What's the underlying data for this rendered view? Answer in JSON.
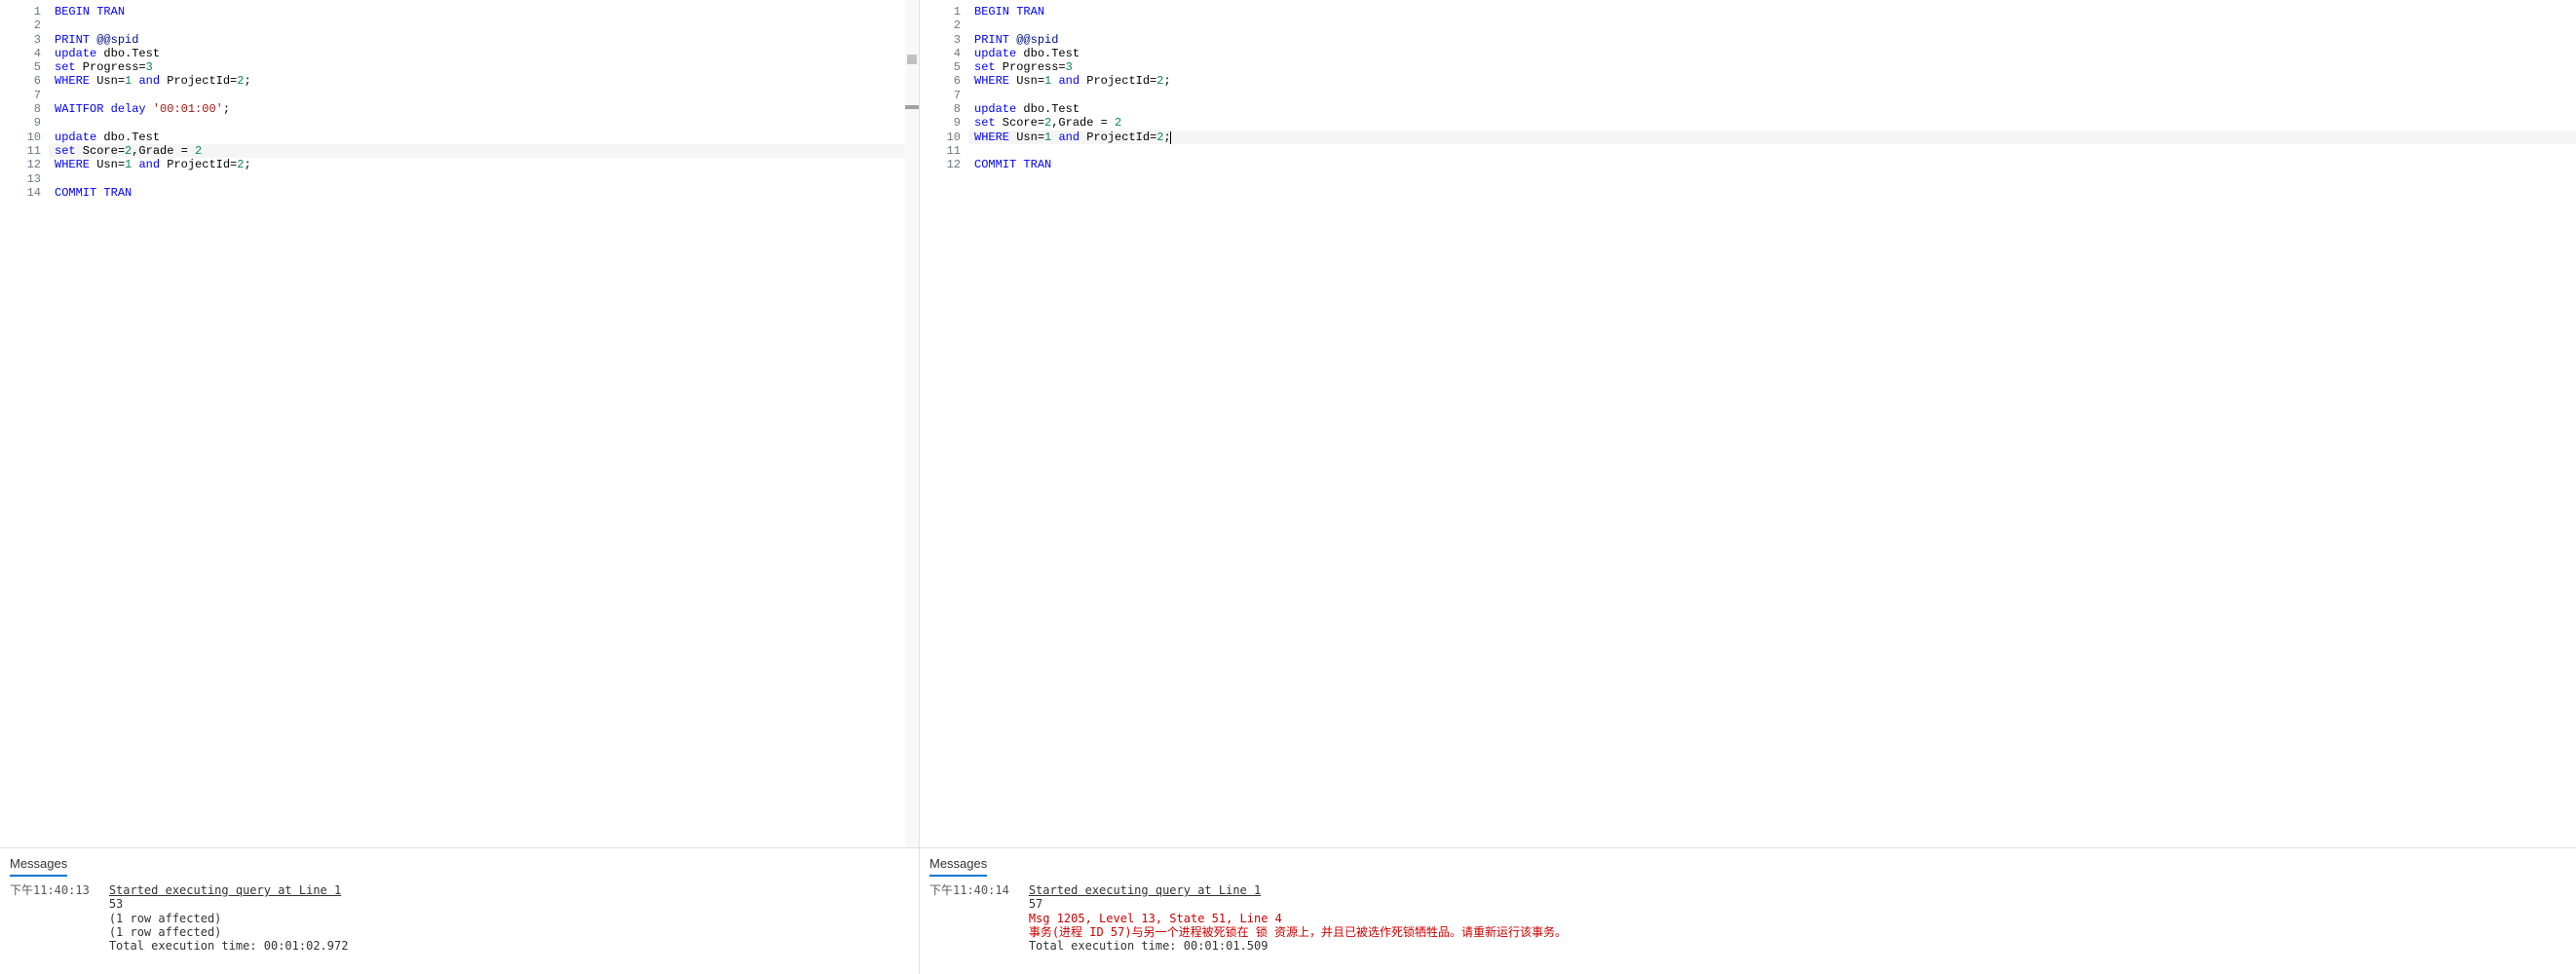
{
  "panes": [
    {
      "id": "left",
      "lines": [
        {
          "n": 1,
          "tokens": [
            [
              "kw",
              "BEGIN"
            ],
            [
              "plain",
              " "
            ],
            [
              "kw",
              "TRAN"
            ]
          ],
          "changed": true
        },
        {
          "n": 2,
          "tokens": [],
          "changed": true
        },
        {
          "n": 3,
          "tokens": [
            [
              "kw",
              "PRINT"
            ],
            [
              "plain",
              " "
            ],
            [
              "var",
              "@@spid"
            ]
          ],
          "changed": true
        },
        {
          "n": 4,
          "tokens": [
            [
              "kw",
              "update"
            ],
            [
              "plain",
              " dbo.Test"
            ]
          ],
          "changed": true
        },
        {
          "n": 5,
          "tokens": [
            [
              "kw",
              "set"
            ],
            [
              "plain",
              " Progress="
            ],
            [
              "num",
              "3"
            ]
          ],
          "changed": true
        },
        {
          "n": 6,
          "tokens": [
            [
              "kw",
              "WHERE"
            ],
            [
              "plain",
              " Usn="
            ],
            [
              "num",
              "1"
            ],
            [
              "plain",
              " "
            ],
            [
              "kw",
              "and"
            ],
            [
              "plain",
              " ProjectId="
            ],
            [
              "num",
              "2"
            ],
            [
              "plain",
              ";"
            ]
          ],
          "changed": true
        },
        {
          "n": 7,
          "tokens": [],
          "changed": true
        },
        {
          "n": 8,
          "tokens": [
            [
              "kw",
              "WAITFOR"
            ],
            [
              "plain",
              " "
            ],
            [
              "kw",
              "delay"
            ],
            [
              "plain",
              " "
            ],
            [
              "str",
              "'00:01:00'"
            ],
            [
              "plain",
              ";"
            ]
          ],
          "changed": true
        },
        {
          "n": 9,
          "tokens": []
        },
        {
          "n": 10,
          "tokens": [
            [
              "kw",
              "update"
            ],
            [
              "plain",
              " dbo.Test"
            ]
          ]
        },
        {
          "n": 11,
          "tokens": [
            [
              "kw",
              "set"
            ],
            [
              "plain",
              " Score="
            ],
            [
              "num",
              "2"
            ],
            [
              "plain",
              ",Grade = "
            ],
            [
              "num",
              "2"
            ]
          ],
          "highlight": true
        },
        {
          "n": 12,
          "tokens": [
            [
              "kw",
              "WHERE"
            ],
            [
              "plain",
              " Usn="
            ],
            [
              "num",
              "1"
            ],
            [
              "plain",
              " "
            ],
            [
              "kw",
              "and"
            ],
            [
              "plain",
              " ProjectId="
            ],
            [
              "num",
              "2"
            ],
            [
              "plain",
              ";"
            ]
          ]
        },
        {
          "n": 13,
          "tokens": []
        },
        {
          "n": 14,
          "tokens": [
            [
              "kw",
              "COMMIT"
            ],
            [
              "plain",
              " "
            ],
            [
              "kw",
              "TRAN"
            ]
          ]
        }
      ],
      "messages": {
        "tab": "Messages",
        "time": "下午11:40:13",
        "header": "Started executing query at Line 1",
        "body": [
          {
            "text": "53"
          },
          {
            "text": "(1 row affected)"
          },
          {
            "text": "(1 row affected)"
          },
          {
            "text": "Total execution time: 00:01:02.972"
          }
        ]
      }
    },
    {
      "id": "right",
      "lines": [
        {
          "n": 1,
          "tokens": [
            [
              "kw",
              "BEGIN"
            ],
            [
              "plain",
              " "
            ],
            [
              "kw",
              "TRAN"
            ]
          ]
        },
        {
          "n": 2,
          "tokens": []
        },
        {
          "n": 3,
          "tokens": [
            [
              "kw",
              "PRINT"
            ],
            [
              "plain",
              " "
            ],
            [
              "var",
              "@@spid"
            ]
          ]
        },
        {
          "n": 4,
          "tokens": [
            [
              "kw",
              "update"
            ],
            [
              "plain",
              " dbo.Test"
            ]
          ]
        },
        {
          "n": 5,
          "tokens": [
            [
              "kw",
              "set"
            ],
            [
              "plain",
              " Progress="
            ],
            [
              "num",
              "3"
            ]
          ]
        },
        {
          "n": 6,
          "tokens": [
            [
              "kw",
              "WHERE"
            ],
            [
              "plain",
              " Usn="
            ],
            [
              "num",
              "1"
            ],
            [
              "plain",
              " "
            ],
            [
              "kw",
              "and"
            ],
            [
              "plain",
              " ProjectId="
            ],
            [
              "num",
              "2"
            ],
            [
              "plain",
              ";"
            ]
          ]
        },
        {
          "n": 7,
          "tokens": []
        },
        {
          "n": 8,
          "tokens": [
            [
              "kw",
              "update"
            ],
            [
              "plain",
              " dbo.Test"
            ]
          ]
        },
        {
          "n": 9,
          "tokens": [
            [
              "kw",
              "set"
            ],
            [
              "plain",
              " Score="
            ],
            [
              "num",
              "2"
            ],
            [
              "plain",
              ",Grade = "
            ],
            [
              "num",
              "2"
            ]
          ]
        },
        {
          "n": 10,
          "tokens": [
            [
              "kw",
              "WHERE"
            ],
            [
              "plain",
              " Usn="
            ],
            [
              "num",
              "1"
            ],
            [
              "plain",
              " "
            ],
            [
              "kw",
              "and"
            ],
            [
              "plain",
              " ProjectId="
            ],
            [
              "num",
              "2"
            ],
            [
              "plain",
              ";"
            ]
          ],
          "highlight": true,
          "cursor": true
        },
        {
          "n": 11,
          "tokens": []
        },
        {
          "n": 12,
          "tokens": [
            [
              "kw",
              "COMMIT"
            ],
            [
              "plain",
              " "
            ],
            [
              "kw",
              "TRAN"
            ]
          ]
        }
      ],
      "messages": {
        "tab": "Messages",
        "time": "下午11:40:14",
        "header": "Started executing query at Line 1",
        "body": [
          {
            "text": "57"
          },
          {
            "text": "Msg 1205, Level 13, State 51, Line 4",
            "err": true
          },
          {
            "text": "事务(进程 ID 57)与另一个进程被死锁在 锁 资源上，并且已被选作死锁牺牲品。请重新运行该事务。",
            "err": true
          },
          {
            "text": "Total execution time: 00:01:01.509"
          }
        ]
      }
    }
  ]
}
